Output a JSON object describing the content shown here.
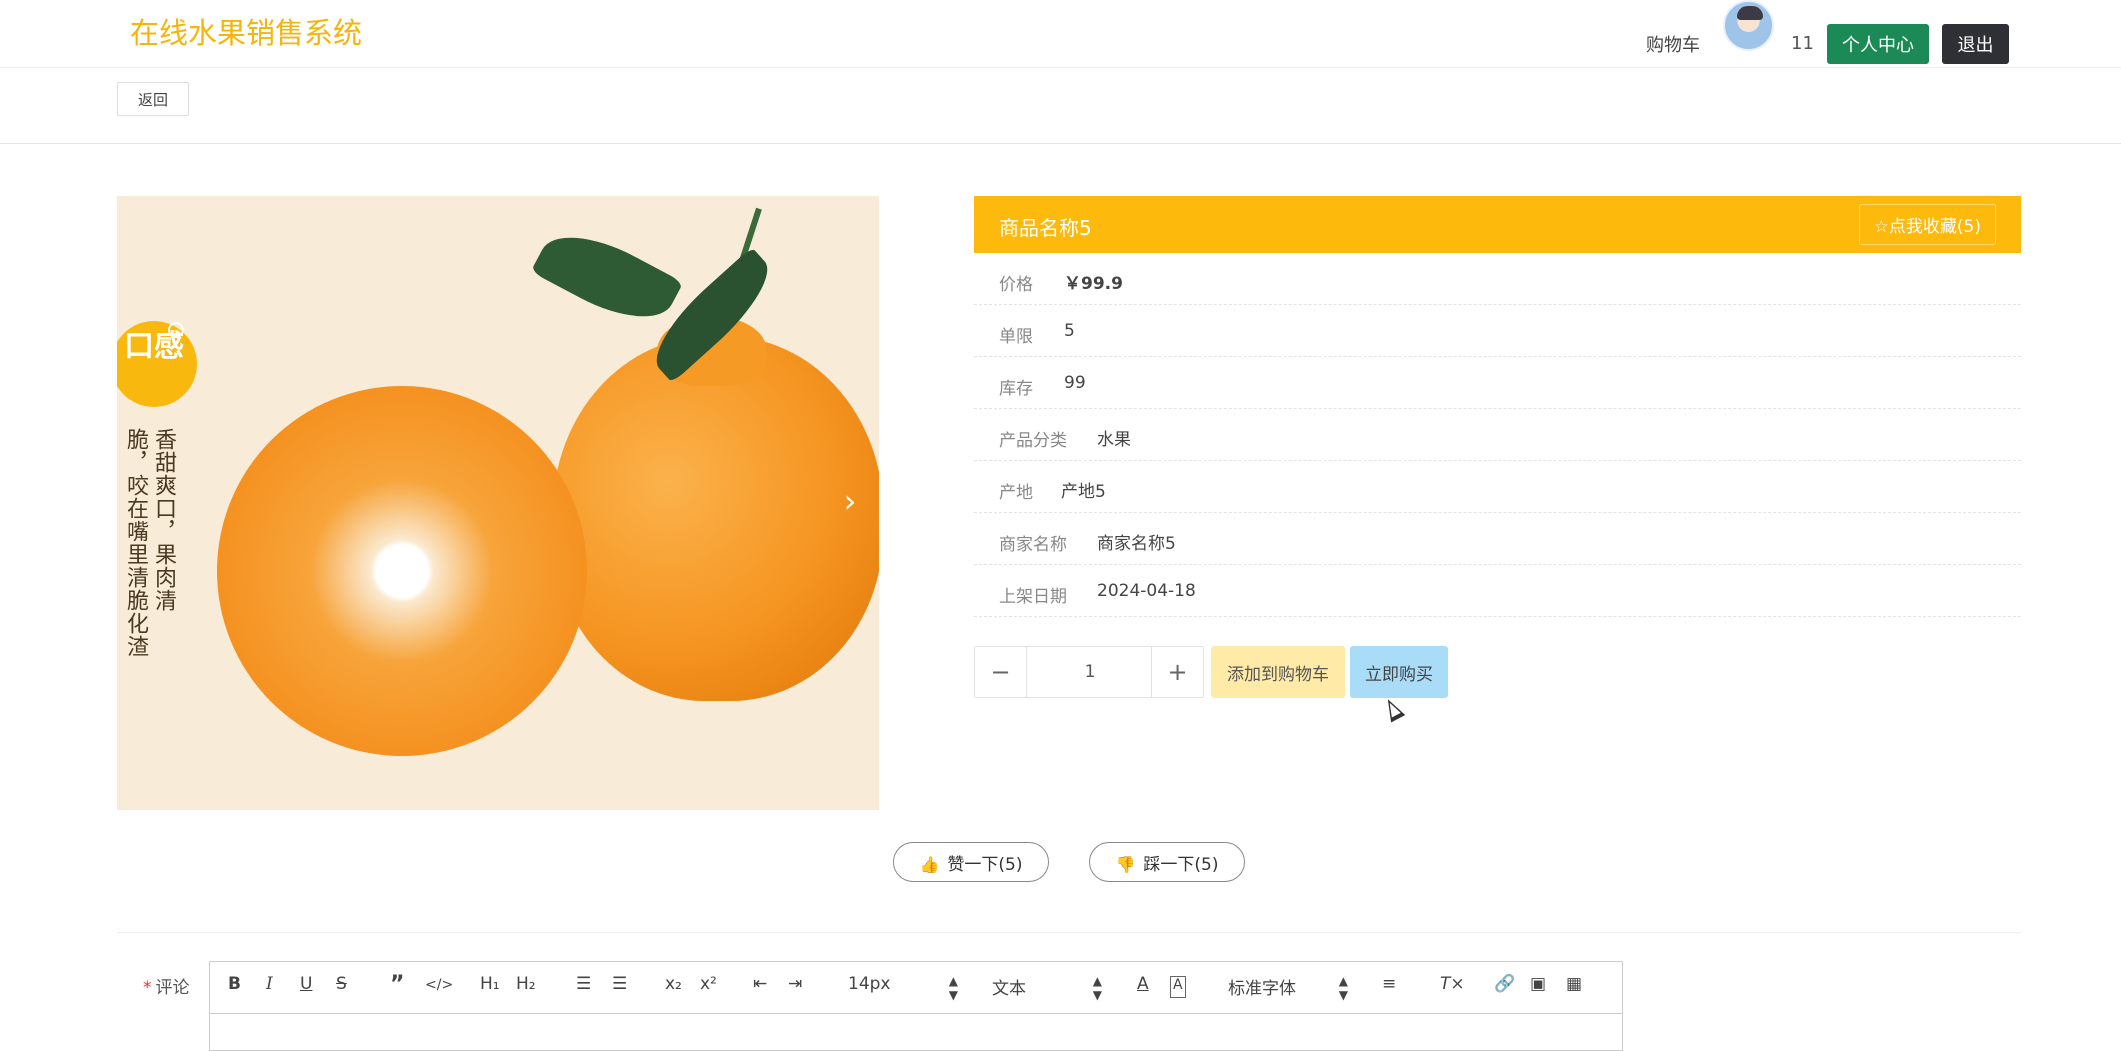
{
  "header": {
    "logo": "在线水果销售系统",
    "cart_label": "购物车",
    "cart_count": "11",
    "user_center_label": "个人中心",
    "logout_label": "退出"
  },
  "subbar": {
    "back_label": "返回"
  },
  "product_image": {
    "badge": "口感",
    "caption_col1": "香甜爽口，果肉清",
    "caption_col2": "脆，咬在嘴里清脆化渣",
    "next_icon": "chevron-right-icon"
  },
  "product": {
    "name": "商品名称5",
    "favorite_label": "点我收藏(5)",
    "fields": [
      {
        "label": "价格",
        "value": "￥99.9"
      },
      {
        "label": "单限",
        "value": "5"
      },
      {
        "label": "库存",
        "value": "99"
      },
      {
        "label": "产品分类",
        "value": "水果"
      },
      {
        "label": "产地",
        "value": "产地5"
      },
      {
        "label": "商家名称",
        "value": "商家名称5"
      },
      {
        "label": "上架日期",
        "value": "2024-04-18"
      }
    ]
  },
  "purchase": {
    "quantity": "1",
    "minus": "−",
    "plus": "+",
    "add_to_cart_label": "添加到购物车",
    "buy_now_label": "立即购买"
  },
  "vote": {
    "like_label": "赞一下(5)",
    "dislike_label": "踩一下(5)"
  },
  "comment": {
    "label": "评论",
    "required_mark": "*",
    "toolbar": {
      "font_size": "14px",
      "text_type": "文本",
      "font_family": "标准字体"
    }
  },
  "colors": {
    "brand": "#f5b50c",
    "header_bar": "#fdb90c",
    "user_center": "#1b8a57",
    "logout": "#2f3035",
    "add_to_cart": "#ffeaa8",
    "buy_now": "#a9dcf7"
  }
}
